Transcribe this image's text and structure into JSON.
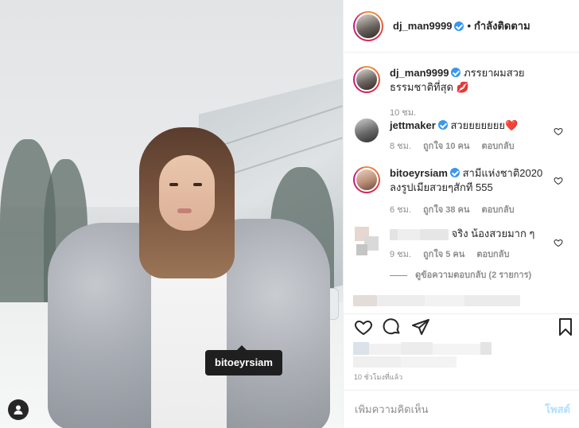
{
  "header": {
    "username": "dj_man9999",
    "separator": "•",
    "follow_state": "กำลังติดตาม"
  },
  "photo": {
    "tag_label": "bitoeyrsiam",
    "tag_user_icon": "person-icon"
  },
  "caption": {
    "username": "dj_man9999",
    "text": "ภรรยาผมสวยธรรมชาติที่สุด 💋",
    "time": "10 ชม."
  },
  "comments": [
    {
      "username": "jettmaker",
      "verified": true,
      "text": "สวยยยยยยย❤️",
      "time": "8 ชม.",
      "likes": "ถูกใจ 10 คน",
      "reply": "ตอบกลับ"
    },
    {
      "username": "bitoeyrsiam",
      "verified": true,
      "text": "สามีแห่งชาติ2020 ลงรูปเมียสวยๆสักที 555",
      "time": "6 ชม.",
      "likes": "ถูกใจ 38 คน",
      "reply": "ตอบกลับ"
    },
    {
      "username": "",
      "verified": false,
      "text": "จริง น้องสวยมาก ๆ",
      "time": "9 ชม.",
      "likes": "ถูกใจ 5 คน",
      "reply": "ตอบกลับ",
      "view_replies": "ดูข้อความตอบกลับ (2 รายการ)"
    }
  ],
  "footer": {
    "time_ago": "10 ชั่วโมงที่แล้ว",
    "add_comment_placeholder": "เพิ่มความคิดเห็น",
    "post_label": "โพสต์"
  },
  "colors": {
    "verified": "#3897f0",
    "heart": "#ed4956",
    "post_disabled": "#b2dffc",
    "meta": "#8e8e8e"
  }
}
